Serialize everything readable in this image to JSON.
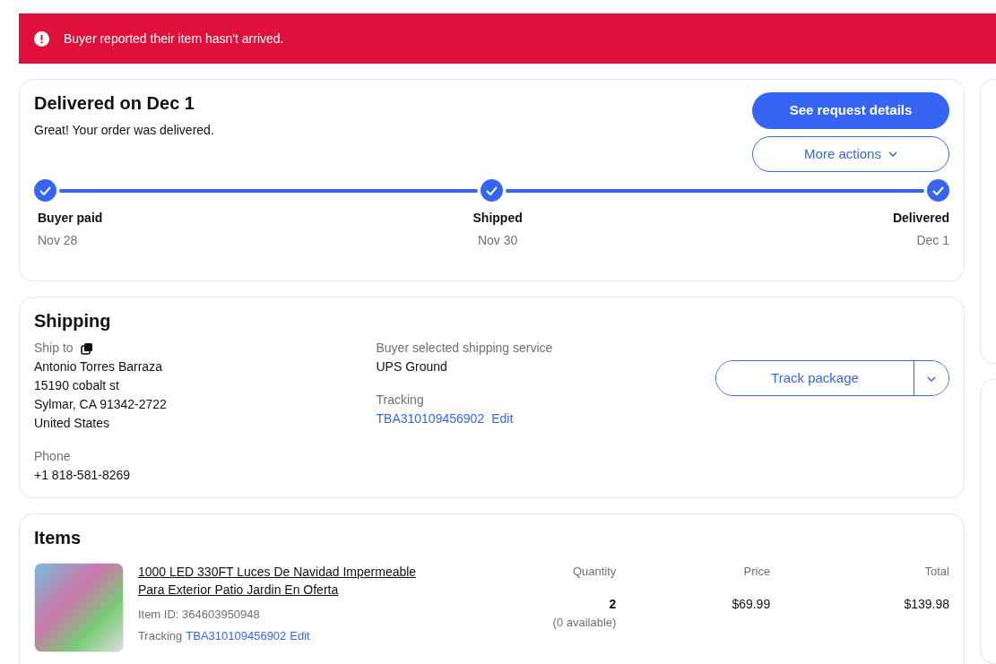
{
  "alert": {
    "text": "Buyer reported their item hasn't arrived."
  },
  "status": {
    "title": "Delivered on Dec 1",
    "message": "Great! Your order was delivered.",
    "buttons": [
      {
        "kind": "primary",
        "label": "See request details"
      },
      {
        "kind": "dropdown",
        "label": "More actions"
      }
    ],
    "steps": [
      {
        "label": "Buyer paid",
        "date": "Nov 28",
        "done": true
      },
      {
        "label": "Shipped",
        "date": "Nov 30",
        "done": true
      },
      {
        "label": "Delivered",
        "date": "Dec 1",
        "done": true
      }
    ]
  },
  "shipping": {
    "title": "Shipping",
    "ship_to_label": "Ship to",
    "address": [
      "Antonio Torres Barraza",
      "15190 cobalt st",
      "Sylmar, CA 91342-2722",
      "United States"
    ],
    "phone_label": "Phone",
    "phone": "+1 818-581-8269",
    "service_label": "Buyer selected shipping service",
    "service": "UPS Ground",
    "tracking_label": "Tracking",
    "tracking_number": "TBA310109456902",
    "edit": "Edit",
    "track_button": "Track package"
  },
  "items": {
    "title": "Items",
    "columns": [
      "Quantity",
      "Price",
      "Total"
    ],
    "rows": [
      {
        "name": "1000 LED 330FT Luces De Navidad Impermeable Para Exterior Patio Jardin En Oferta",
        "item_id": "Item ID: 364603950948",
        "tracking_label": "Tracking",
        "tracking_number": "TBA310109456902",
        "edit": "Edit",
        "quantity": "2",
        "available": "(0 available)",
        "price": "$69.99",
        "total": "$139.98"
      }
    ]
  }
}
